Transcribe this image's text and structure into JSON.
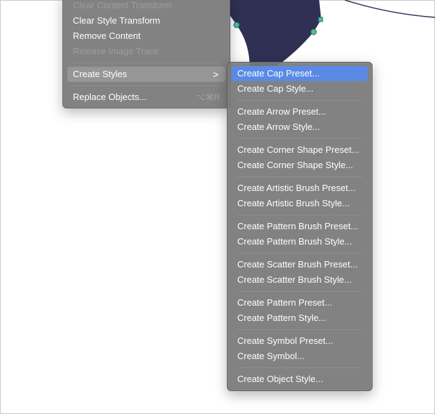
{
  "colors": {
    "artwork_fill": "#2f3054",
    "anchor_green": "#4fcc5c",
    "highlight_blue": "#5a8ae6"
  },
  "main_menu": {
    "clear_content_transform": "Clear Content Transform",
    "clear_style_transform": "Clear Style Transform",
    "remove_content": "Remove Content",
    "release_image_trace": "Release Image Trace",
    "create_styles": "Create Styles",
    "replace_objects": "Replace Objects...",
    "replace_objects_shortcut": "⌥⌘R",
    "submenu_chevron": ">"
  },
  "submenu": {
    "items": [
      "Create Cap Preset...",
      "Create Cap Style...",
      "Create Arrow Preset...",
      "Create Arrow Style...",
      "Create Corner Shape Preset...",
      "Create Corner Shape Style...",
      "Create Artistic Brush Preset...",
      "Create Artistic Brush Style...",
      "Create Pattern Brush Preset...",
      "Create Pattern Brush Style...",
      "Create Scatter Brush Preset...",
      "Create Scatter Brush Style...",
      "Create Pattern Preset...",
      "Create Pattern Style...",
      "Create Symbol Preset...",
      "Create Symbol...",
      "Create Object Style..."
    ]
  }
}
